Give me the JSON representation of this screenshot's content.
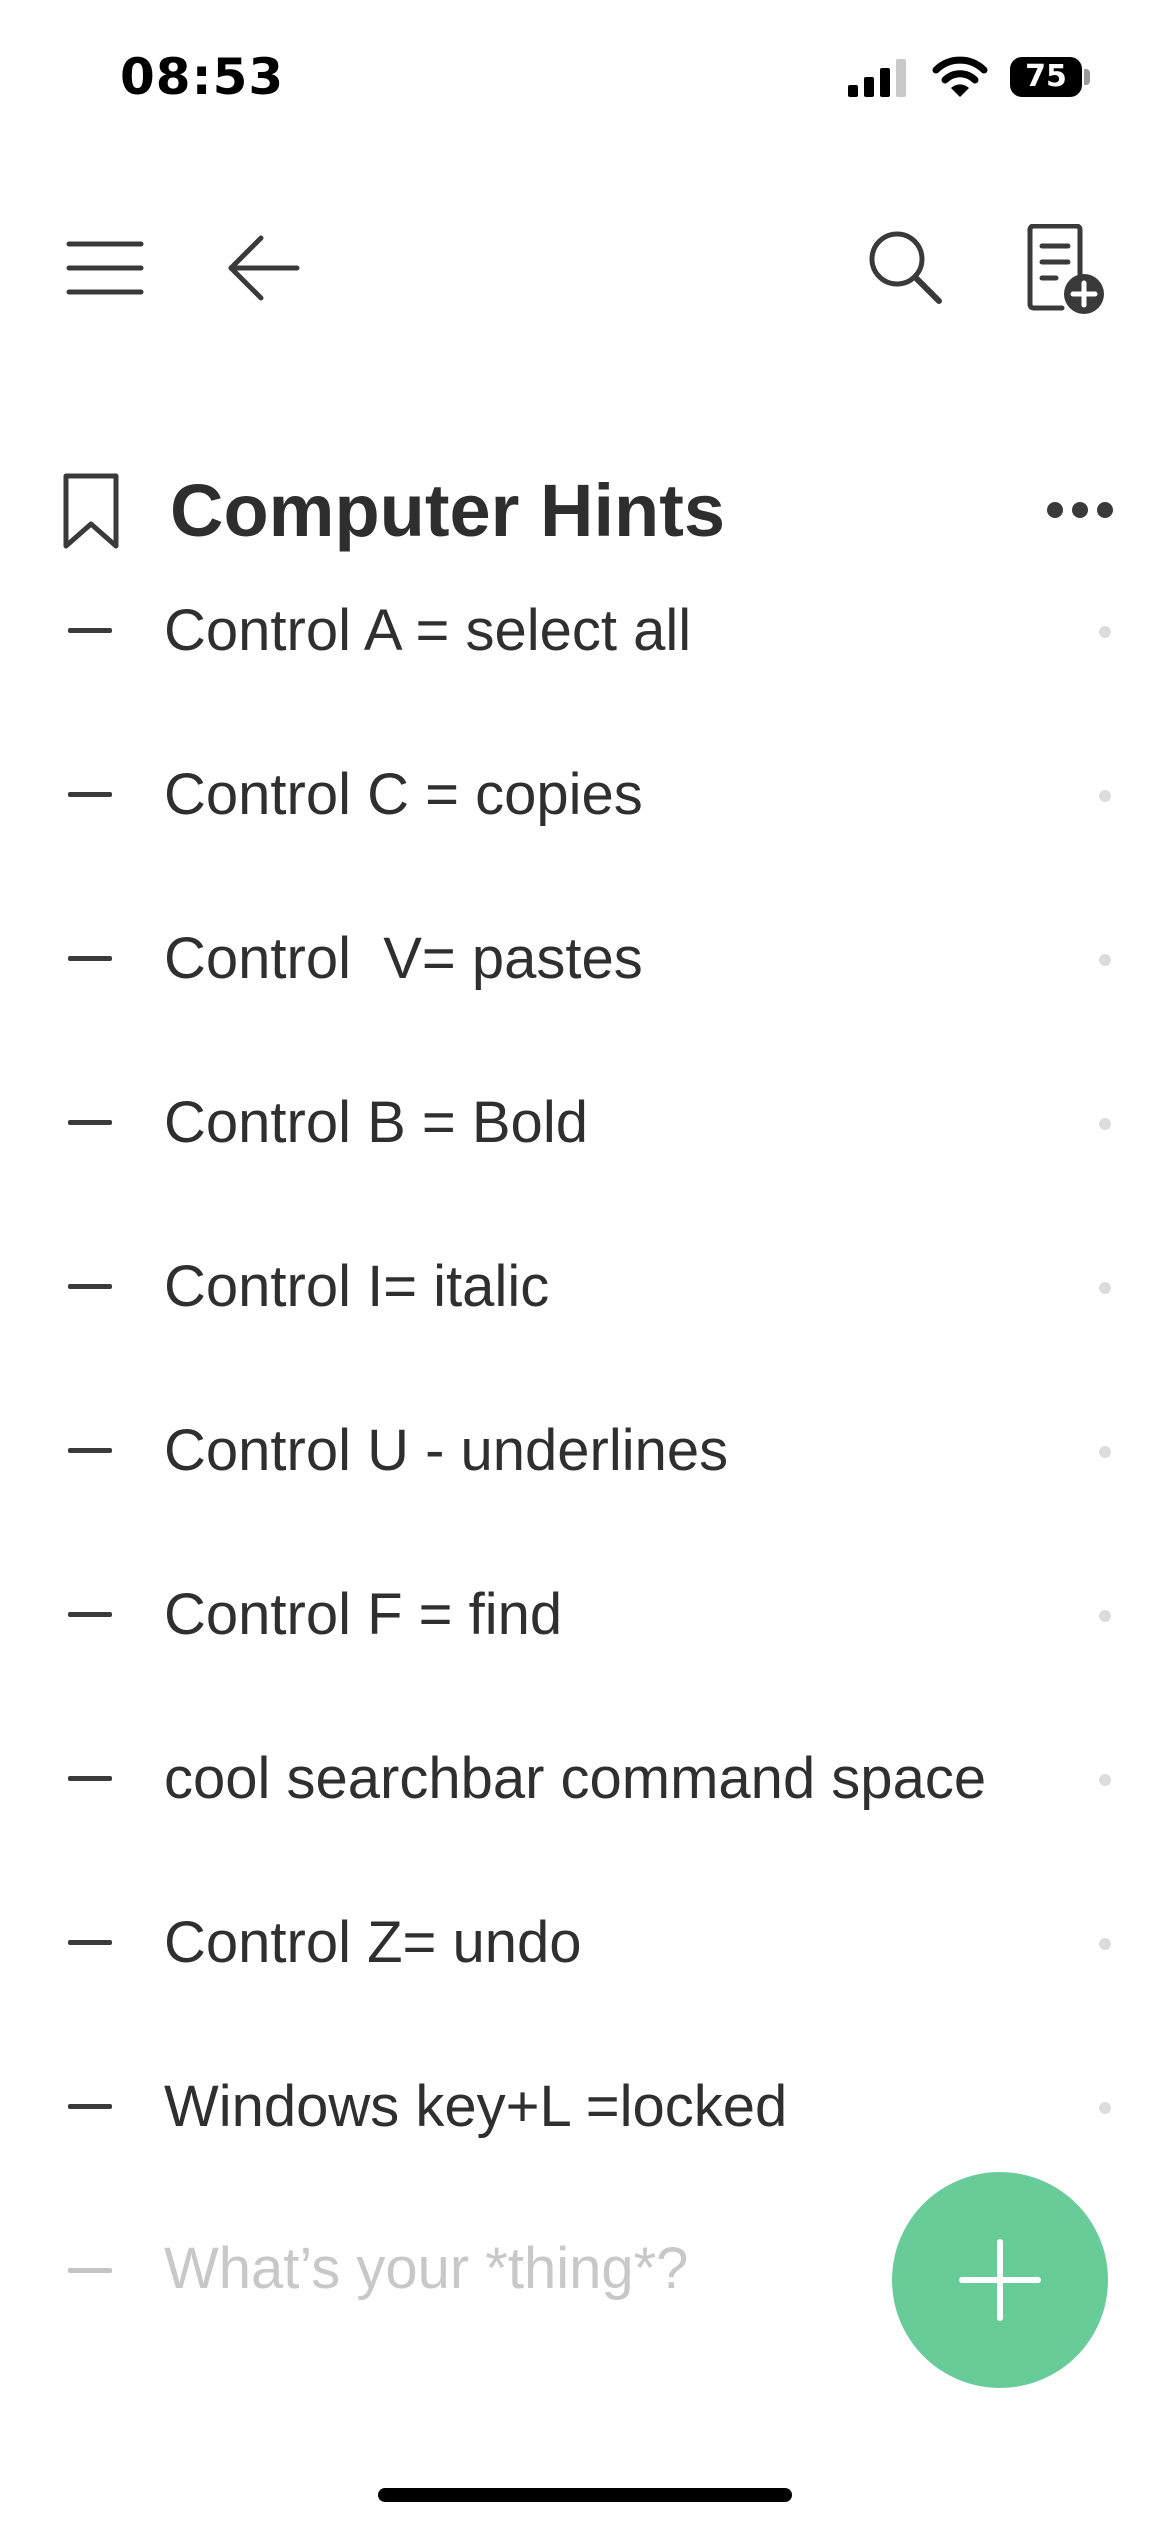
{
  "status_bar": {
    "time": "08:53",
    "battery_level": "75",
    "signal_icon": "cellular-signal-icon",
    "wifi_icon": "wifi-icon"
  },
  "toolbar": {
    "menu_icon": "hamburger-menu-icon",
    "back_icon": "arrow-left-icon",
    "search_icon": "search-icon",
    "new_note_icon": "new-note-icon"
  },
  "list": {
    "title": "Computer Hints",
    "bookmark_icon": "bookmark-icon",
    "more_icon": "more-horizontal-icon",
    "items": [
      {
        "text": "Control A = select all"
      },
      {
        "text": "Control C = copies"
      },
      {
        "text": "Control  V= pastes"
      },
      {
        "text": "Control B = Bold"
      },
      {
        "text": "Control I= italic"
      },
      {
        "text": "Control U - underlines"
      },
      {
        "text": "Control F = find"
      },
      {
        "text": "cool searchbar command space"
      },
      {
        "text": "Control Z= undo"
      },
      {
        "text": "Windows key+L =locked"
      }
    ],
    "new_item_placeholder": "What’s your *thing*?"
  },
  "fab": {
    "icon": "plus-icon"
  },
  "colors": {
    "accent": "#68cc98",
    "text": "#2f2f2f",
    "placeholder": "#c8c8c8"
  }
}
